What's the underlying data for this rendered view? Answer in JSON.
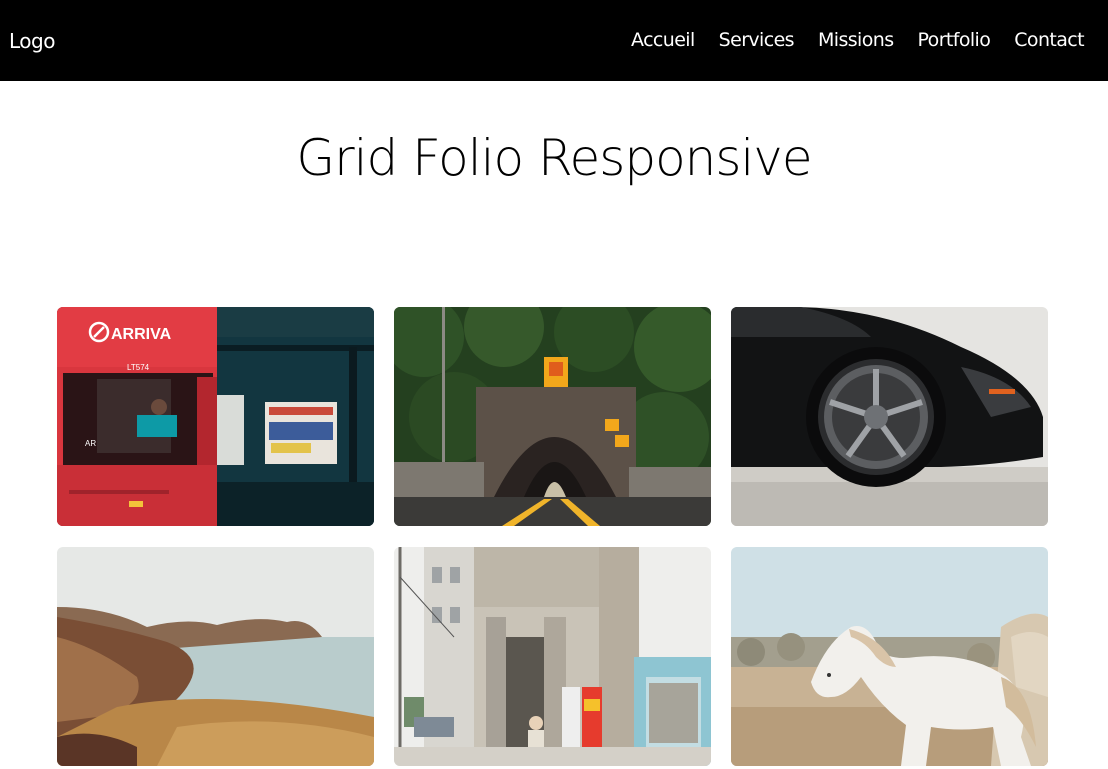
{
  "header": {
    "logo": "Logo",
    "nav": [
      "Accueil",
      "Services",
      "Missions",
      "Portfolio",
      "Contact"
    ]
  },
  "main": {
    "title": "Grid Folio Responsive"
  },
  "gallery": {
    "bus_brand": "ARRIVA",
    "bus_number": "LT574",
    "bus_route": "AR"
  },
  "colors": {
    "header_bg": "#000000",
    "header_text": "#ffffff",
    "page_bg": "#ffffff"
  }
}
